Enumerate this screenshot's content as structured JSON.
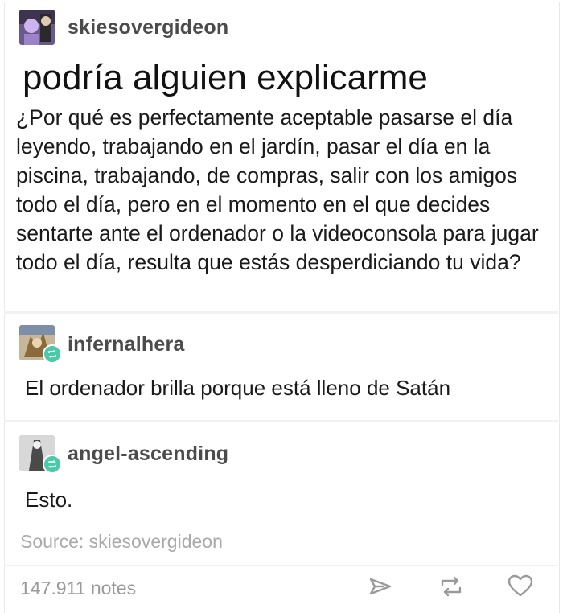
{
  "post": {
    "author": "skiesovergideon",
    "title": "podría alguien explicarme",
    "body": "¿Por qué es perfectamente aceptable pasarse el día leyendo, trabajando en el jardín, pasar el día en la piscina, trabajando, de compras, salir con los amigos todo el día, pero en el momento en el que decides sentarte ante el ordenador o la videoconsola para jugar todo el día, resulta que estás desperdiciando tu vida?"
  },
  "reblogs": [
    {
      "author": "infernalhera",
      "text": "El ordenador brilla porque está lleno de Satán"
    },
    {
      "author": "angel-ascending",
      "text": "Esto."
    }
  ],
  "footer": {
    "source": "Source: skiesovergideon",
    "notes": "147.911 notes"
  },
  "icons": {
    "share": "paper-plane-icon",
    "reblog": "reblog-icon",
    "like": "heart-icon"
  },
  "colors": {
    "reblog_badge": "#4cc9a8",
    "meta_text": "#a9a9a9"
  }
}
